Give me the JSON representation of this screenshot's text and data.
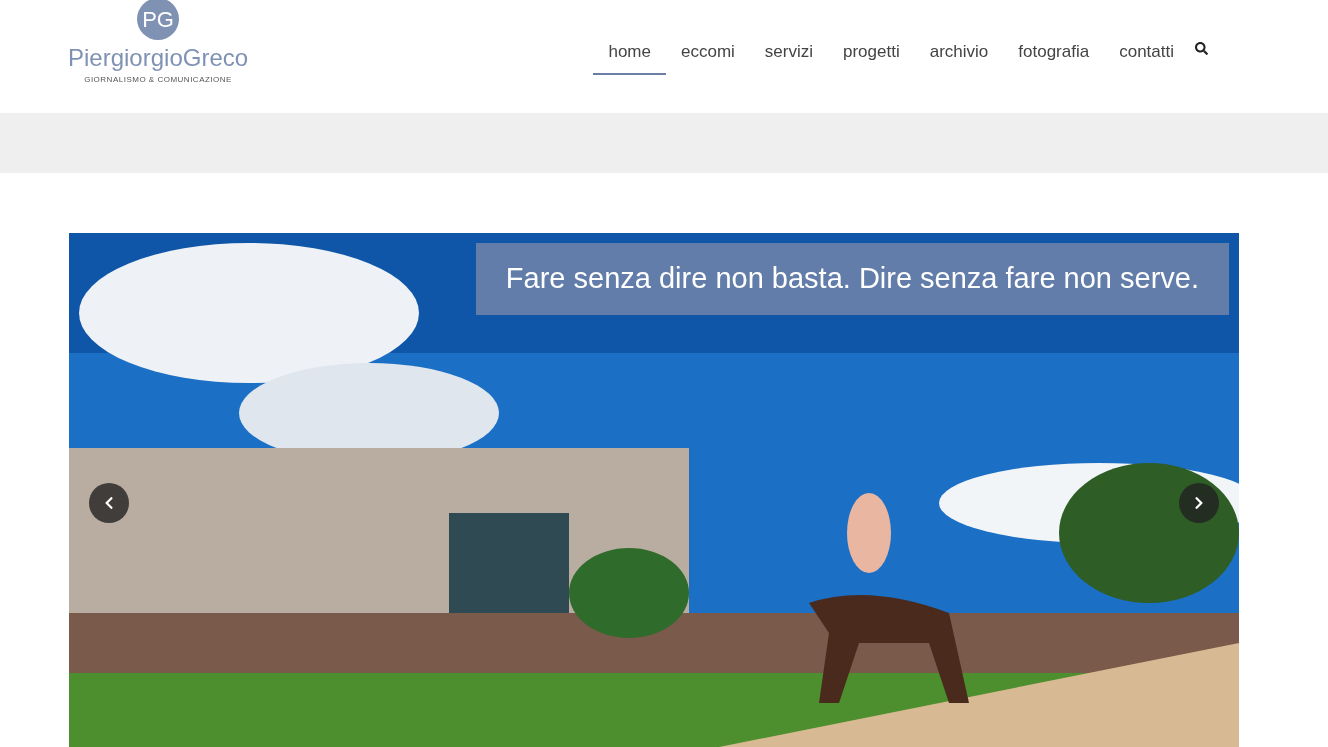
{
  "logo": {
    "monogram": "PG",
    "name": "PiergiorgioGreco",
    "tagline": "GIORNALISMO & COMUNICAZIONE"
  },
  "nav": [
    {
      "label": "home",
      "selected": true
    },
    {
      "label": "eccomi",
      "selected": false
    },
    {
      "label": "servizi",
      "selected": false
    },
    {
      "label": "progetti",
      "selected": false
    },
    {
      "label": "archivio",
      "selected": false
    },
    {
      "label": "fotografia",
      "selected": false
    },
    {
      "label": "contatti",
      "selected": false
    }
  ],
  "slider": {
    "caption": "Fare senza dire non basta. Dire senza fare non serve."
  }
}
